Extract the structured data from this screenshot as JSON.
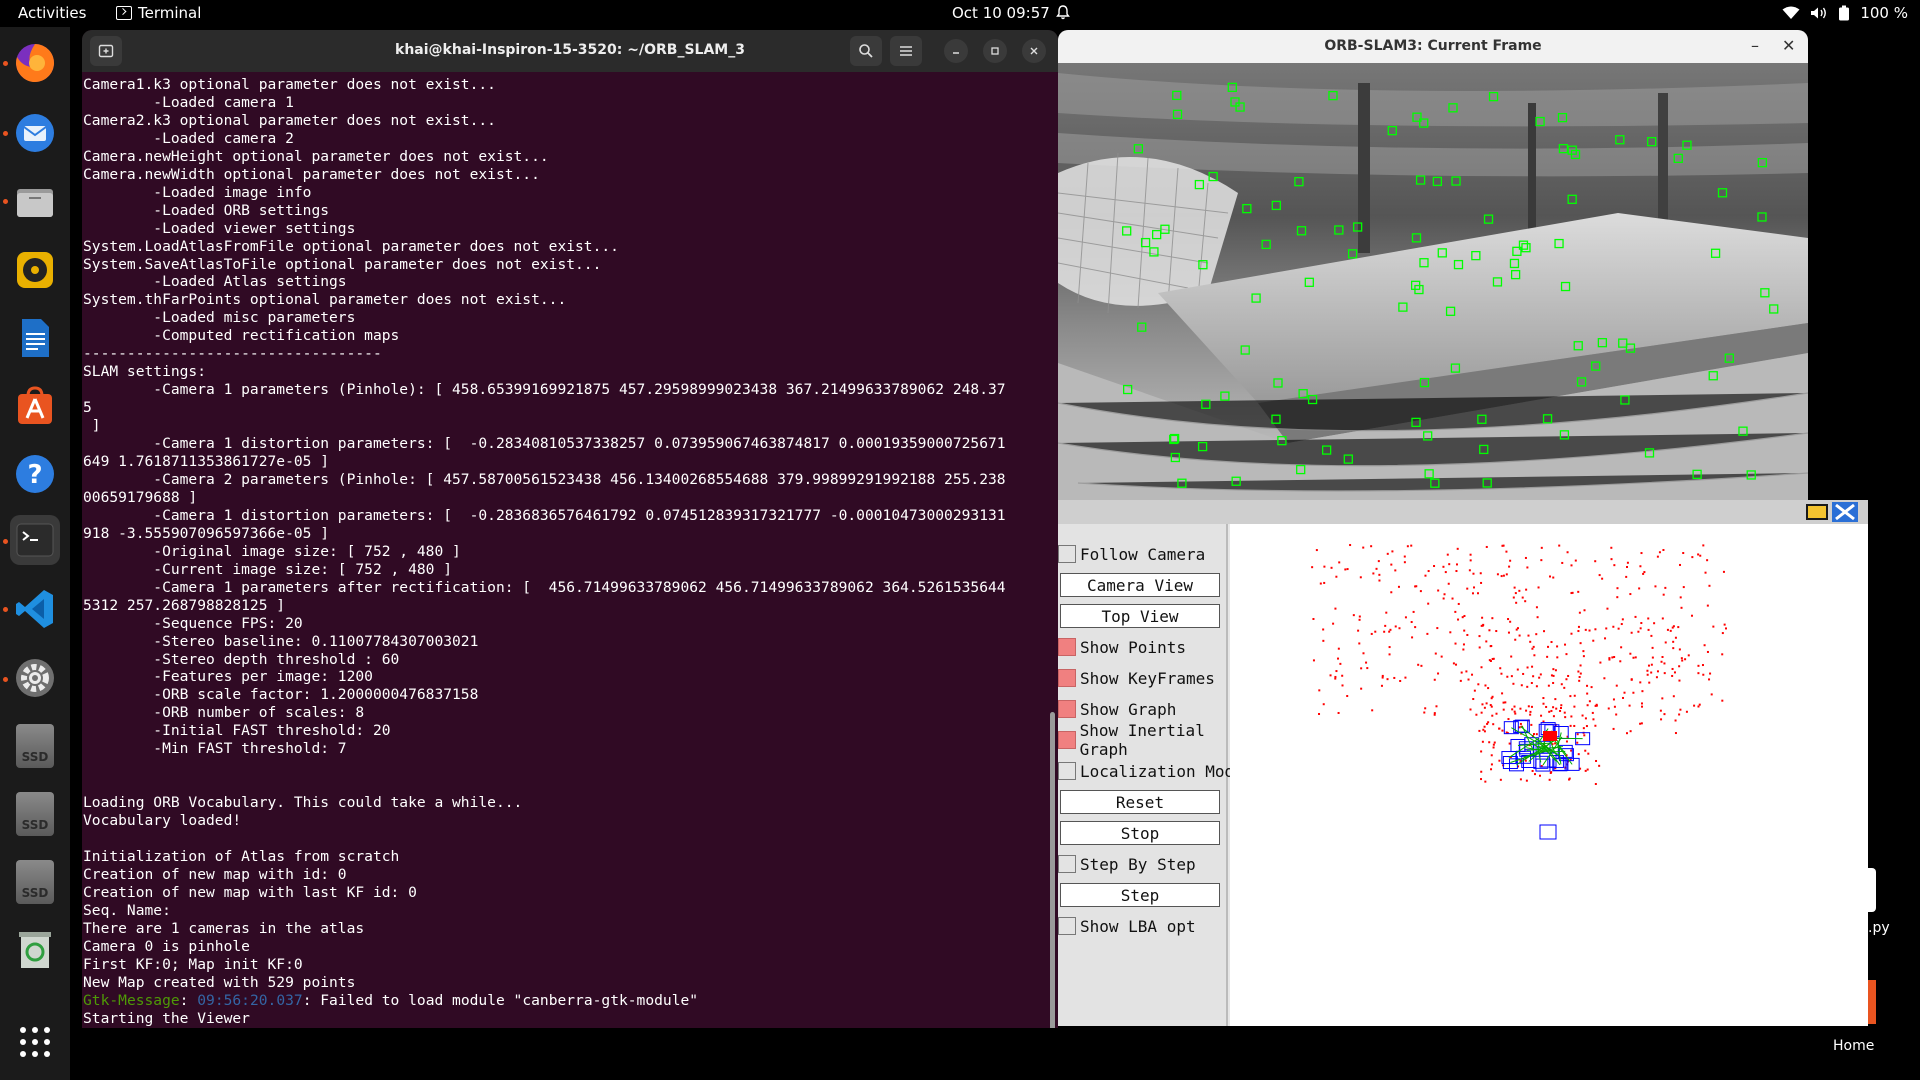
{
  "topbar": {
    "activities": "Activities",
    "app_name": "Terminal",
    "clock": "Oct 10  09:57",
    "battery": "100 %"
  },
  "dock": {
    "items": [
      {
        "name": "firefox-icon",
        "active": false
      },
      {
        "name": "thunderbird-icon",
        "active": false
      },
      {
        "name": "files-icon",
        "active": false
      },
      {
        "name": "rhythmbox-icon",
        "active": false
      },
      {
        "name": "writer-icon",
        "active": false
      },
      {
        "name": "software-icon",
        "active": false
      },
      {
        "name": "help-icon",
        "active": false
      },
      {
        "name": "terminal-icon",
        "active": true
      },
      {
        "name": "vscode-icon",
        "active": false
      },
      {
        "name": "settings-icon",
        "active": false
      },
      {
        "name": "ssd-drive-icon",
        "active": false
      },
      {
        "name": "ssd-drive-icon",
        "active": false
      },
      {
        "name": "ssd-drive-icon",
        "active": false
      },
      {
        "name": "trash-icon",
        "active": false
      }
    ],
    "ssd_label": "SSD",
    "show_apps_icon": "grid-icon"
  },
  "terminal": {
    "title": "khai@khai-Inspiron-15-3520: ~/ORB_SLAM_3",
    "lines": [
      "Camera1.k3 optional parameter does not exist...",
      "        -Loaded camera 1",
      "Camera2.k3 optional parameter does not exist...",
      "        -Loaded camera 2",
      "Camera.newHeight optional parameter does not exist...",
      "Camera.newWidth optional parameter does not exist...",
      "        -Loaded image info",
      "        -Loaded ORB settings",
      "        -Loaded viewer settings",
      "System.LoadAtlasFromFile optional parameter does not exist...",
      "System.SaveAtlasToFile optional parameter does not exist...",
      "        -Loaded Atlas settings",
      "System.thFarPoints optional parameter does not exist...",
      "        -Loaded misc parameters",
      "        -Computed rectification maps",
      "----------------------------------",
      "SLAM settings: ",
      "        -Camera 1 parameters (Pinhole): [ 458.65399169921875 457.29598999023438 367.21499633789062 248.375",
      " ]",
      "        -Camera 1 distortion parameters: [  -0.28340810537338257 0.073959067463874817 0.00019359000725671649 1.7618711353861727e-05 ]",
      "        -Camera 2 parameters (Pinhole: [ 457.58700561523438 456.13400268554688 379.99899291992188 255.23800659179688 ]",
      "        -Camera 1 distortion parameters: [  -0.2836836576461792 0.074512839317321777 -0.00010473000293131918 -3.555907096597366e-05 ]",
      "        -Original image size: [ 752 , 480 ]",
      "        -Current image size: [ 752 , 480 ]",
      "        -Camera 1 parameters after rectification: [  456.71499633789062 456.71499633789062 364.52615356445312 257.268798828125 ]",
      "        -Sequence FPS: 20",
      "        -Stereo baseline: 0.11007784307003021",
      "        -Stereo depth threshold : 60",
      "        -Features per image: 1200",
      "        -ORB scale factor: 1.2000000476837158",
      "        -ORB number of scales: 8",
      "        -Initial FAST threshold: 20",
      "        -Min FAST threshold: 7",
      "",
      "",
      "Loading ORB Vocabulary. This could take a while...",
      "Vocabulary loaded!",
      "",
      "Initialization of Atlas from scratch",
      "Creation of new map with id: 0",
      "Creation of new map with last KF id: 0",
      "Seq. Name: ",
      "There are 1 cameras in the atlas",
      "Camera 0 is pinhole",
      "First KF:0; Map init KF:0",
      "New Map created with 529 points"
    ],
    "gtk_word1": "Gtk-",
    "gtk_word2": "Message",
    "gtk_time": "09:56:20.037",
    "gtk_rest": ": Failed to load module \"canberra-gtk-module\"",
    "last_line": "Starting the Viewer"
  },
  "frame_window": {
    "title": "ORB-SLAM3: Current Frame"
  },
  "viewer": {
    "controls": [
      {
        "type": "check",
        "label": "Follow Camera",
        "on": false
      },
      {
        "type": "button",
        "label": "Camera View"
      },
      {
        "type": "button",
        "label": "Top View"
      },
      {
        "type": "check",
        "label": "Show Points",
        "on": true
      },
      {
        "type": "check",
        "label": "Show KeyFrames",
        "on": true
      },
      {
        "type": "check",
        "label": "Show Graph",
        "on": true
      },
      {
        "type": "check",
        "label": "Show Inertial Graph",
        "on": true
      },
      {
        "type": "check",
        "label": "Localization Mode",
        "on": false
      },
      {
        "type": "button",
        "label": "Reset"
      },
      {
        "type": "button",
        "label": "Stop"
      },
      {
        "type": "check",
        "label": "Step By Step",
        "on": false
      },
      {
        "type": "button",
        "label": "Step"
      },
      {
        "type": "check",
        "label": "Show LBA opt",
        "on": false
      }
    ],
    "colors": {
      "map_points": "#ff0000",
      "keyframes": "#0000ff",
      "graph": "#00aa00",
      "current": "#ff0000"
    }
  },
  "desktop": {
    "py_label": ".py",
    "home_label": "Home"
  }
}
